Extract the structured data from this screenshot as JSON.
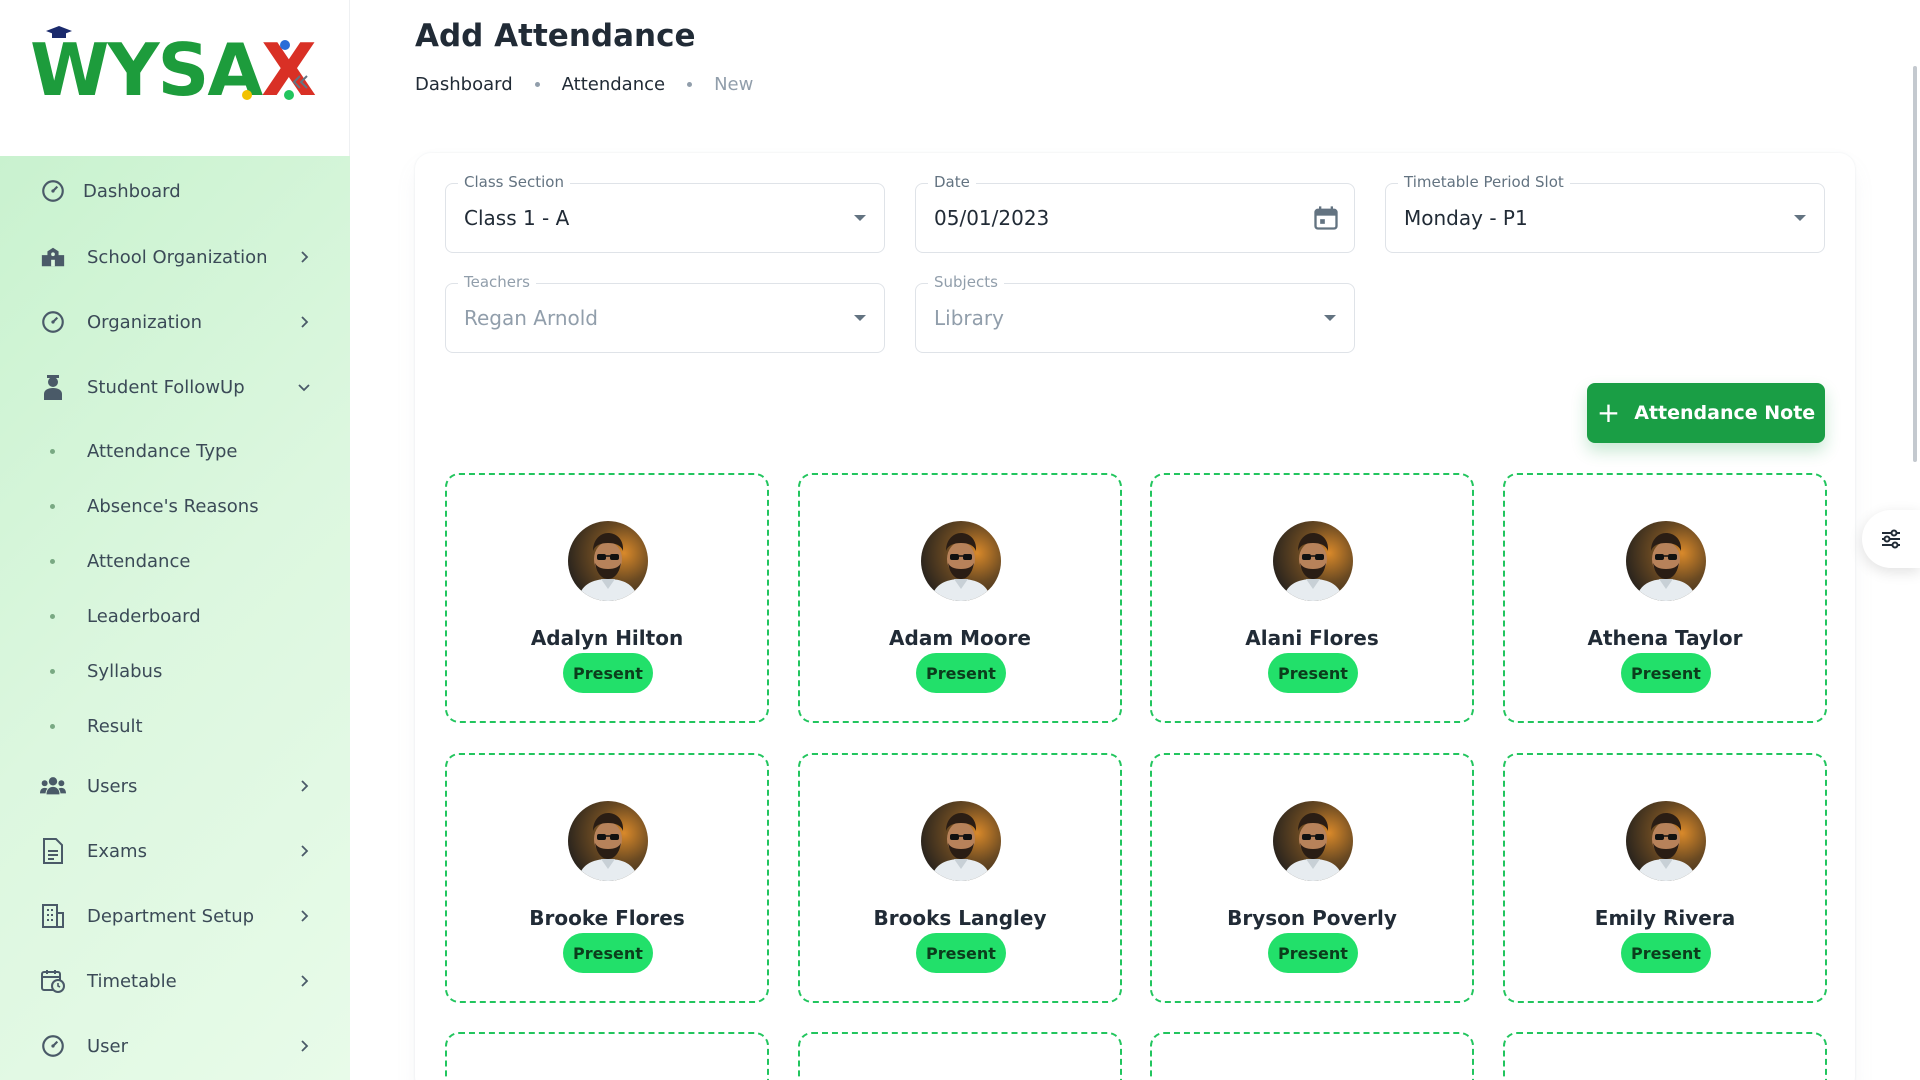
{
  "brand": {
    "logo_text_main": "WYSA",
    "logo_text_x": "X",
    "primary_color": "#1d9c3c",
    "accent_color": "#22c55e"
  },
  "sidebar": {
    "collapse_icon": "double-chevron-left-icon",
    "items": [
      {
        "label": "Dashboard",
        "icon": "dashboard-icon"
      },
      {
        "label": "School Organization",
        "icon": "school-icon"
      },
      {
        "label": "Organization",
        "icon": "dashboard-icon"
      },
      {
        "label": "Student FollowUp",
        "icon": "student-icon"
      },
      {
        "label": "Users",
        "icon": "users-icon"
      },
      {
        "label": "Exams",
        "icon": "document-icon"
      },
      {
        "label": "Department Setup",
        "icon": "building-icon"
      },
      {
        "label": "Timetable",
        "icon": "calendar-clock-icon"
      },
      {
        "label": "User",
        "icon": "dashboard-icon"
      }
    ],
    "sub_items": [
      {
        "label": "Attendance Type"
      },
      {
        "label": "Absence's Reasons"
      },
      {
        "label": "Attendance"
      },
      {
        "label": "Leaderboard"
      },
      {
        "label": "Syllabus"
      },
      {
        "label": "Result"
      }
    ]
  },
  "header": {
    "title": "Add Attendance",
    "breadcrumb": [
      "Dashboard",
      "Attendance",
      "New"
    ]
  },
  "form": {
    "class_section": {
      "label": "Class Section",
      "value": "Class 1 - A"
    },
    "date": {
      "label": "Date",
      "value": "05/01/2023"
    },
    "period": {
      "label": "Timetable Period Slot",
      "value": "Monday - P1"
    },
    "teachers": {
      "label": "Teachers",
      "value": "Regan Arnold"
    },
    "subjects": {
      "label": "Subjects",
      "value": "Library"
    }
  },
  "note_button": {
    "label": "Attendance Note"
  },
  "students": [
    {
      "name": "Adalyn Hilton",
      "status": "Present"
    },
    {
      "name": "Adam Moore",
      "status": "Present"
    },
    {
      "name": "Alani Flores",
      "status": "Present"
    },
    {
      "name": "Athena Taylor",
      "status": "Present"
    },
    {
      "name": "Brooke Flores",
      "status": "Present"
    },
    {
      "name": "Brooks Langley",
      "status": "Present"
    },
    {
      "name": "Bryson Poverly",
      "status": "Present"
    },
    {
      "name": "Emily Rivera",
      "status": "Present"
    }
  ]
}
